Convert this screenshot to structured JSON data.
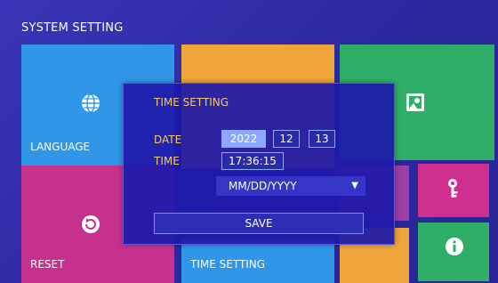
{
  "header": {
    "title": "SYSTEM SETTING"
  },
  "tiles": {
    "language": "LANGUAGE",
    "reset": "RESET",
    "time_setting": "TIME SETTING"
  },
  "icons": {
    "language": "globe-icon",
    "display": "photo-icon",
    "reset": "reset-icon",
    "password": "key-icon",
    "info": "info-icon"
  },
  "dialog": {
    "title": "TIME SETTING",
    "date_label": "DATE",
    "time_label": "TIME",
    "year": "2022",
    "month": "12",
    "day": "13",
    "time": "17:36:15",
    "date_format": "MM/DD/YYYY",
    "save_label": "SAVE"
  },
  "colors": {
    "background": "#2e2a9e",
    "tile_blue": "#2f96e8",
    "tile_orange": "#f0a53a",
    "tile_green": "#2fae68",
    "tile_magenta": "#c7318e",
    "dialog_label": "#f5c86a"
  }
}
